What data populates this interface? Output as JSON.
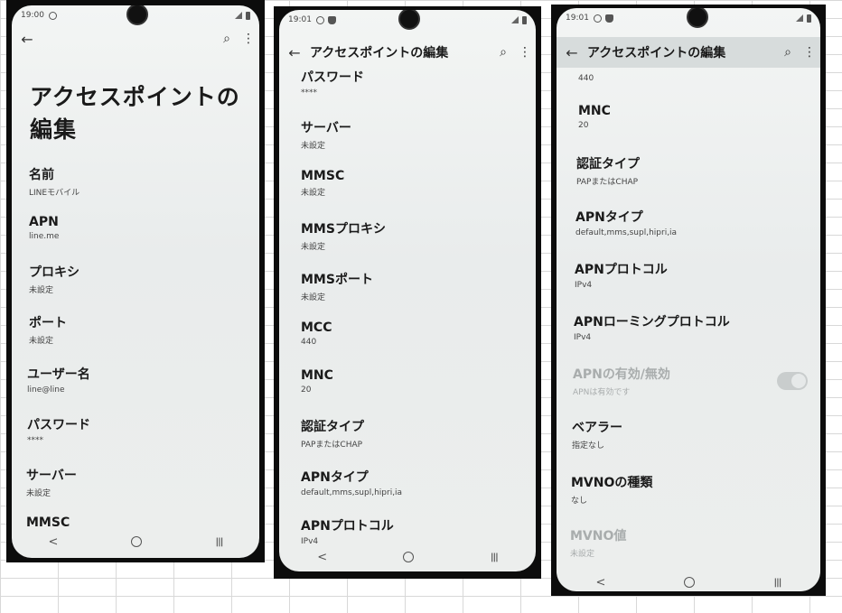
{
  "status": {
    "time1": "19:00",
    "time2": "19:01",
    "time3": "19:01"
  },
  "title": "アクセスポイントの編集",
  "big_title_line1": "アクセスポイントの",
  "big_title_line2": "編集",
  "icons": {
    "back": "arrow-left-icon",
    "search": "search-icon",
    "more": "more-vert-icon"
  },
  "nav": {
    "back": "<",
    "recent": "|||"
  },
  "fields": {
    "name": {
      "label": "名前",
      "value": "LINEモバイル"
    },
    "apn": {
      "label": "APN",
      "value": "line.me"
    },
    "proxy": {
      "label": "プロキシ",
      "value": "未設定"
    },
    "port": {
      "label": "ポート",
      "value": "未設定"
    },
    "username": {
      "label": "ユーザー名",
      "value": "line@line"
    },
    "password": {
      "label": "パスワード",
      "value": "****"
    },
    "server": {
      "label": "サーバー",
      "value": "未設定"
    },
    "mmsc": {
      "label": "MMSC",
      "value": "未設定"
    },
    "mms_proxy": {
      "label": "MMSプロキシ",
      "value": "未設定"
    },
    "mms_port": {
      "label": "MMSポート",
      "value": "未設定"
    },
    "mcc": {
      "label": "MCC",
      "value": "440"
    },
    "mnc": {
      "label": "MNC",
      "value": "20"
    },
    "auth_type": {
      "label": "認証タイプ",
      "value": "PAPまたはCHAP"
    },
    "apn_type": {
      "label": "APNタイプ",
      "value": "default,mms,supl,hipri,ia"
    },
    "apn_protocol": {
      "label": "APNプロトコル",
      "value": "IPv4"
    },
    "apn_roaming_protocol": {
      "label": "APNローミングプロトコル",
      "value": "IPv4"
    },
    "apn_enable": {
      "label": "APNの有効/無効",
      "value": "APNは有効です",
      "enabled": true
    },
    "bearer": {
      "label": "ベアラー",
      "value": "指定なし"
    },
    "mvno_type": {
      "label": "MVNOの種類",
      "value": "なし"
    },
    "mvno_value": {
      "label": "MVNO値",
      "value": "未設定"
    }
  }
}
